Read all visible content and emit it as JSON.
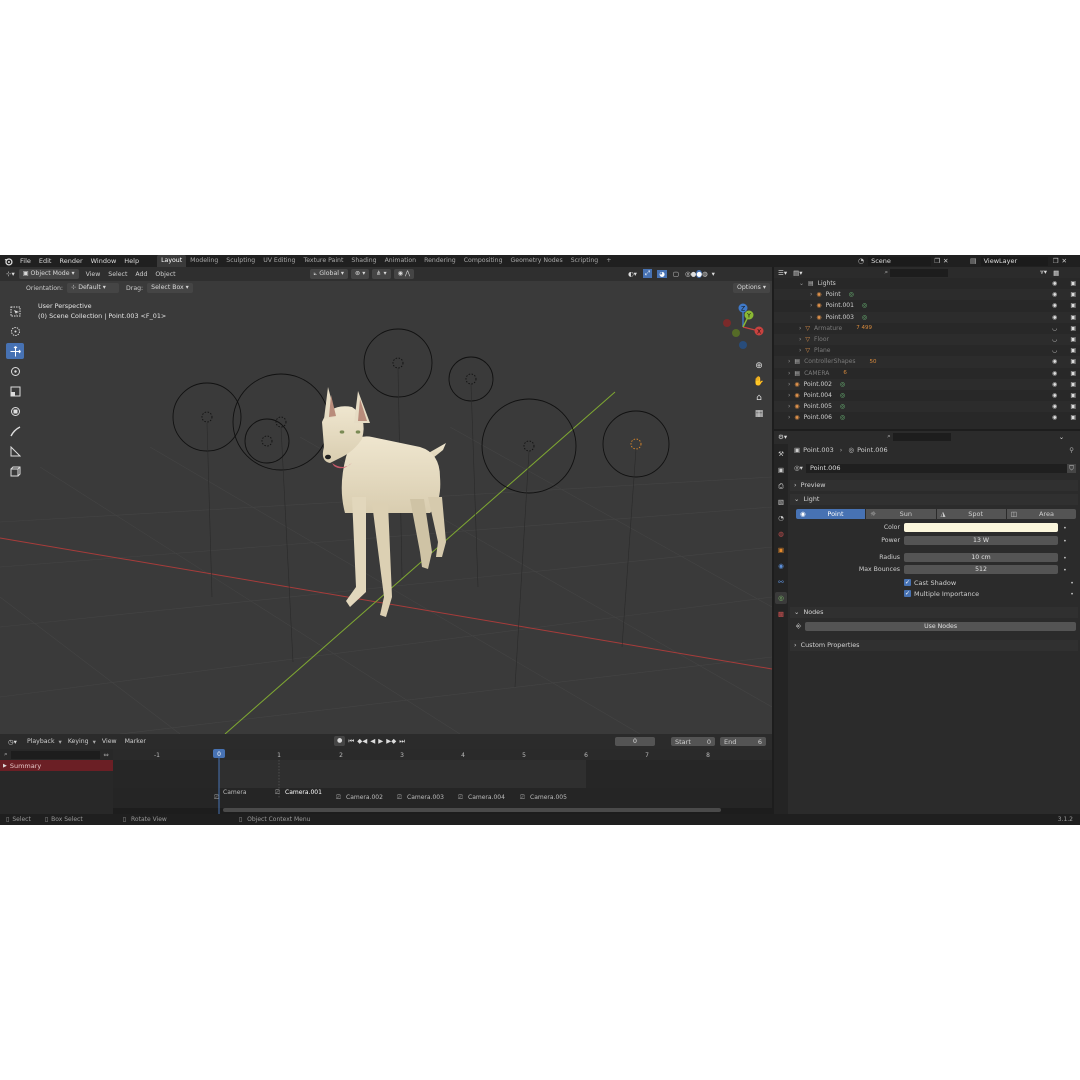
{
  "menubar": {
    "menus": [
      "File",
      "Edit",
      "Render",
      "Window",
      "Help"
    ],
    "workspaces": [
      "Layout",
      "Modeling",
      "Sculpting",
      "UV Editing",
      "Texture Paint",
      "Shading",
      "Animation",
      "Rendering",
      "Compositing",
      "Geometry Nodes",
      "Scripting"
    ],
    "active_workspace": "Layout",
    "add_tab": "+",
    "scene": "Scene",
    "view_layer": "ViewLayer"
  },
  "viewport": {
    "mode": "Object Mode",
    "menus": [
      "View",
      "Select",
      "Add",
      "Object"
    ],
    "transform": "Global",
    "orientation_label": "Orientation:",
    "orientation_value": "Default",
    "drag_label": "Drag:",
    "drag_value": "Select Box",
    "options": "Options",
    "overlay_title": "User Perspective",
    "overlay_subtitle": "(0) Scene Collection | Point.003 <F_01>",
    "gizmo": {
      "x": "X",
      "y": "Y",
      "z": "Z"
    }
  },
  "timeline": {
    "menus": [
      "Playback",
      "Keying",
      "View",
      "Marker"
    ],
    "current_frame": "0",
    "start_label": "Start",
    "start_value": "0",
    "end_label": "End",
    "end_value": "6",
    "frame_ticks": [
      "-1",
      "0",
      "1",
      "2",
      "3",
      "4",
      "5",
      "6",
      "7",
      "8"
    ],
    "summary": "Summary",
    "markers": [
      "Camera",
      "Camera.001",
      "Camera.002",
      "Camera.003",
      "Camera.004",
      "Camera.005"
    ]
  },
  "statusbar": {
    "items": [
      "Select",
      "Box Select",
      "Rotate View",
      "Object Context Menu"
    ],
    "version": "3.1.2"
  },
  "outliner": {
    "rows": [
      {
        "name": "Lights",
        "indent": 1,
        "dim": false
      },
      {
        "name": "Point",
        "indent": 2,
        "dim": false
      },
      {
        "name": "Point.001",
        "indent": 2,
        "dim": false
      },
      {
        "name": "Point.003",
        "indent": 2,
        "dim": false
      },
      {
        "name": "Armature",
        "indent": 1,
        "dim": true
      },
      {
        "name": "Floor",
        "indent": 1,
        "dim": true
      },
      {
        "name": "Plane",
        "indent": 1,
        "dim": true
      },
      {
        "name": "ControllerShapes",
        "indent": 0,
        "dim": true
      },
      {
        "name": "CAMERA",
        "indent": 0,
        "dim": true
      },
      {
        "name": "Point.002",
        "indent": 0,
        "dim": false
      },
      {
        "name": "Point.004",
        "indent": 0,
        "dim": false
      },
      {
        "name": "Point.005",
        "indent": 0,
        "dim": false
      },
      {
        "name": "Point.006",
        "indent": 0,
        "dim": false
      }
    ],
    "badge_armature": "7 499",
    "badge_controller": "50",
    "badge_camera": "6"
  },
  "properties": {
    "breadcrumb_object": "Point.003",
    "breadcrumb_data": "Point.006",
    "datablock": "Point.006",
    "sections": {
      "preview": "Preview",
      "light": "Light",
      "nodes": "Nodes",
      "custom": "Custom Properties"
    },
    "light_types": [
      "Point",
      "Sun",
      "Spot",
      "Area"
    ],
    "active_light_type": "Point",
    "color_label": "Color",
    "color_value": "#fbf6dc",
    "power_label": "Power",
    "power_value": "13 W",
    "radius_label": "Radius",
    "radius_value": "10 cm",
    "bounces_label": "Max Bounces",
    "bounces_value": "512",
    "cast_shadow": "Cast Shadow",
    "multiple_importance": "Multiple Importance",
    "use_nodes": "Use Nodes"
  },
  "colors": {
    "accent": "#4772b3",
    "x_axis": "#c8423f",
    "y_axis": "#8ab834",
    "z_axis": "#3f79c8"
  }
}
